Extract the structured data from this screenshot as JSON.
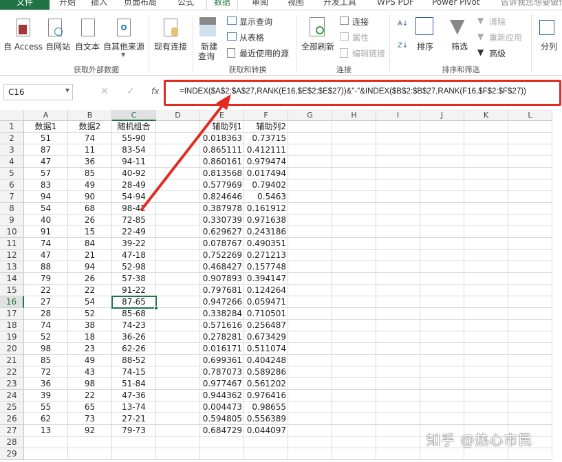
{
  "tabs": [
    "文件",
    "开始",
    "插入",
    "页面布局",
    "公式",
    "数据",
    "审阅",
    "视图",
    "开发工具",
    "WPS PDF",
    "Power Pivot",
    "告诉我您想要做什么"
  ],
  "ribbon": {
    "get_external": {
      "access": "自 Access",
      "web": "自网站",
      "text": "自文本",
      "other": "自其他来源",
      "group": "获取外部数据"
    },
    "existing": "现有连接",
    "transform": {
      "new_query_1": "新建",
      "new_query_2": "查询",
      "show_query": "显示查询",
      "from_table": "从表格",
      "recent": "最近使用的源",
      "group": "获取和转换"
    },
    "connections": {
      "refresh_all": "全部刷新",
      "connections": "连接",
      "properties": "属性",
      "edit_links": "编辑链接",
      "group": "连接"
    },
    "sort_filter": {
      "sort": "排序",
      "filter": "筛选",
      "clear": "清除",
      "reapply": "重新应用",
      "advanced": "高级",
      "group": "排序和筛选"
    },
    "text_to_columns": "分列"
  },
  "formula_bar": {
    "name_box": "C16",
    "fx": "fx",
    "formula": "=INDEX($A$2:$A$27,RANK(E16,$E$2:$E$27))&\"-\"&INDEX($B$2:$B$27,RANK(F16,$F$2:$F$27))"
  },
  "columns": [
    "A",
    "B",
    "C",
    "D",
    "E",
    "F",
    "G",
    "H",
    "I",
    "J",
    "K",
    "L"
  ],
  "header_row": [
    "数据1",
    "数据2",
    "随机组合",
    "",
    "辅助列1",
    "辅助列2"
  ],
  "rows": [
    [
      "51",
      "74",
      "55-90",
      "0.018363",
      "0.73715"
    ],
    [
      "87",
      "11",
      "83-54",
      "0.865111",
      "0.412111"
    ],
    [
      "47",
      "36",
      "94-11",
      "0.860161",
      "0.979474"
    ],
    [
      "57",
      "85",
      "40-92",
      "0.813568",
      "0.017494"
    ],
    [
      "83",
      "49",
      "28-49",
      "0.577969",
      "0.79402"
    ],
    [
      "94",
      "90",
      "54-94",
      "0.824646",
      "0.5463"
    ],
    [
      "54",
      "68",
      "98-42",
      "0.387978",
      "0.161912"
    ],
    [
      "40",
      "26",
      "72-85",
      "0.330739",
      "0.971638"
    ],
    [
      "91",
      "15",
      "22-49",
      "0.629627",
      "0.243186"
    ],
    [
      "74",
      "84",
      "39-22",
      "0.078767",
      "0.490351"
    ],
    [
      "47",
      "21",
      "47-18",
      "0.752269",
      "0.271213"
    ],
    [
      "88",
      "94",
      "52-98",
      "0.468427",
      "0.157748"
    ],
    [
      "79",
      "26",
      "57-38",
      "0.907893",
      "0.394147"
    ],
    [
      "22",
      "22",
      "91-22",
      "0.797681",
      "0.124264"
    ],
    [
      "27",
      "54",
      "87-65",
      "0.947266",
      "0.059471"
    ],
    [
      "28",
      "52",
      "85-68",
      "0.338284",
      "0.710501"
    ],
    [
      "74",
      "38",
      "74-23",
      "0.571616",
      "0.256487"
    ],
    [
      "52",
      "18",
      "36-26",
      "0.278281",
      "0.673429"
    ],
    [
      "98",
      "23",
      "62-26",
      "0.016171",
      "0.511074"
    ],
    [
      "85",
      "49",
      "88-52",
      "0.699361",
      "0.404248"
    ],
    [
      "72",
      "43",
      "74-15",
      "0.787073",
      "0.589286"
    ],
    [
      "36",
      "98",
      "51-84",
      "0.977467",
      "0.561202"
    ],
    [
      "39",
      "22",
      "47-36",
      "0.944362",
      "0.976416"
    ],
    [
      "55",
      "65",
      "13-74",
      "0.004473",
      "0.98655"
    ],
    [
      "62",
      "73",
      "27-21",
      "0.594805",
      "0.556389"
    ],
    [
      "13",
      "92",
      "79-73",
      "0.684729",
      "0.044097"
    ]
  ],
  "total_rows": 29,
  "selected_row": 16,
  "selected_col": "C",
  "watermark": "知乎 @热心市民",
  "colors": {
    "accent": "#217346",
    "annotation": "#e22b22"
  }
}
